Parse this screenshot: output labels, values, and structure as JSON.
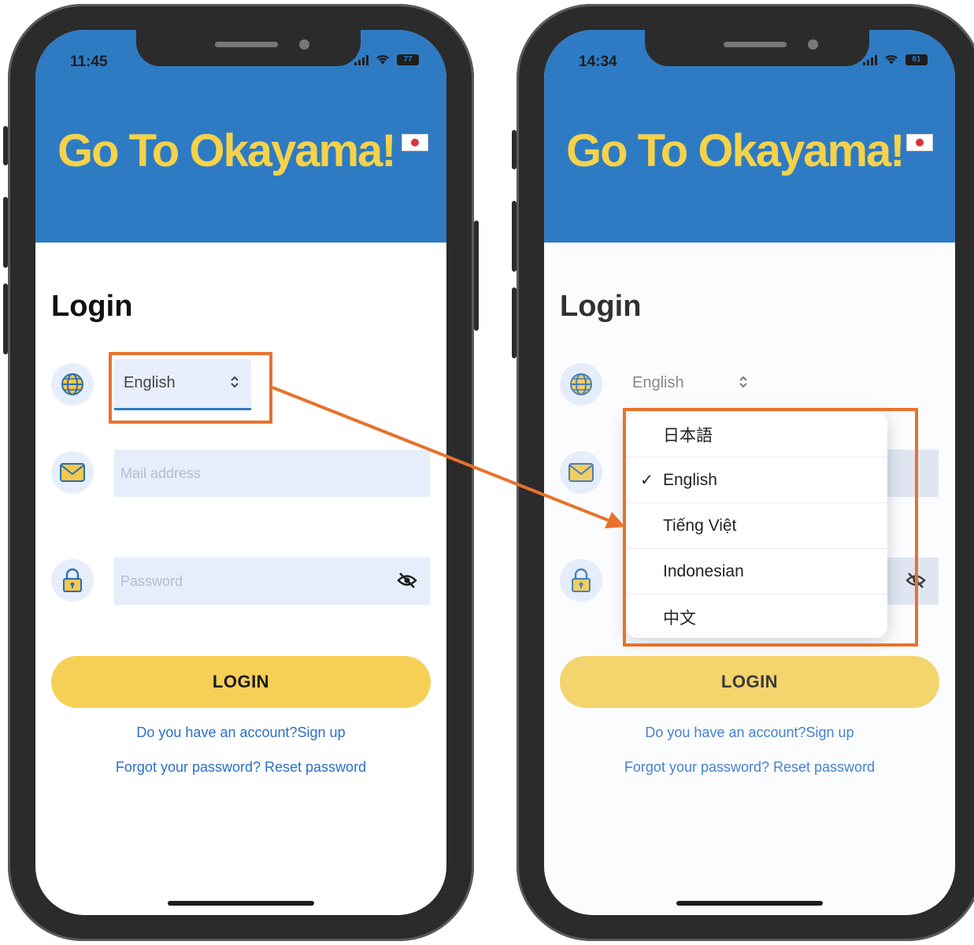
{
  "left_screen": {
    "status": {
      "time": "11:45",
      "battery": "77"
    },
    "header": {
      "title": "Go To Okayama!"
    },
    "login_title": "Login",
    "language": {
      "selected": "English",
      "chevron": "⌃⌄"
    },
    "mail": {
      "placeholder": "Mail address"
    },
    "password": {
      "placeholder": "Password"
    },
    "login_button": "LOGIN",
    "signup_link": "Do you have an account?Sign up",
    "reset_link": "Forgot your password? Reset password"
  },
  "right_screen": {
    "status": {
      "time": "14:34",
      "battery": "61"
    },
    "header": {
      "title": "Go To Okayama!"
    },
    "login_title": "Login",
    "language": {
      "selected": "English",
      "chevron": "⌃⌄"
    },
    "dropdown": {
      "options": [
        {
          "label": "日本語",
          "checked": false
        },
        {
          "label": "English",
          "checked": true
        },
        {
          "label": "Tiếng Việt",
          "checked": false
        },
        {
          "label": "Indonesian",
          "checked": false
        },
        {
          "label": "中文",
          "checked": false
        }
      ],
      "check_mark": "✓"
    },
    "login_button": "LOGIN",
    "signup_link": "Do you have an account?Sign up",
    "reset_link": "Forgot your password? Reset password"
  },
  "colors": {
    "header_blue": "#2e7bc4",
    "brand_yellow": "#f5d24a",
    "button_yellow": "#f6d056",
    "link_blue": "#2a6fc9",
    "annotation_orange": "#e8722c"
  }
}
